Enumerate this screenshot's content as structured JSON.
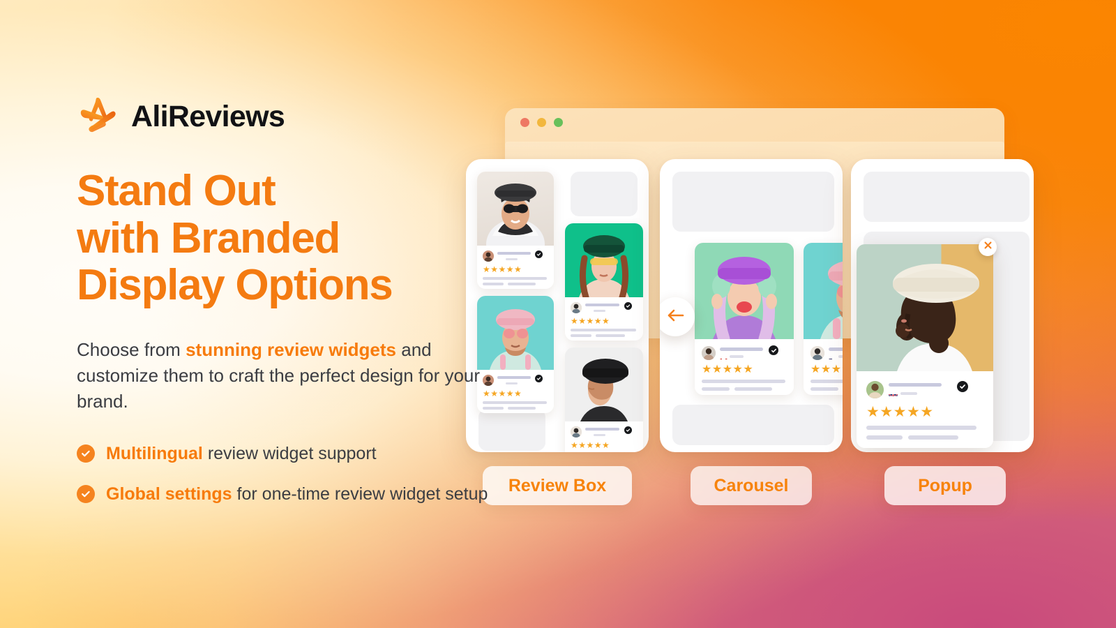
{
  "brand": {
    "logo_icon": "alireviews-star-logo",
    "name": "AliReviews"
  },
  "hero": {
    "headline": "Stand Out\nwith Branded\nDisplay Options",
    "subcopy_pre": "Choose from ",
    "subcopy_highlight": "stunning review widgets",
    "subcopy_post": " and customize them to craft the perfect design for your brand."
  },
  "bullets": [
    {
      "highlight": "Multilingual",
      "rest": " review widget support",
      "icon": "check-circle-icon"
    },
    {
      "highlight": "Global settings",
      "rest": " for one-time review widget setup",
      "icon": "check-circle-icon"
    }
  ],
  "browser": {
    "traffic_lights": [
      "red",
      "yellow",
      "green"
    ]
  },
  "widgets": [
    {
      "id": "review-box",
      "label": "Review Box",
      "type": "masonry-grid",
      "reviews": [
        {
          "stars": 5,
          "flag": "canada",
          "verified": true,
          "photo_bg": "#EDE7E1"
        },
        {
          "stars": 5,
          "flag": "canada",
          "verified": true,
          "photo_bg": "#6FD3D0"
        },
        {
          "stars": 5,
          "flag": "usa",
          "verified": true,
          "photo_bg": "#0FC08A"
        },
        {
          "stars": 5,
          "flag": "usa",
          "verified": true,
          "photo_bg": "#EFEFEF"
        }
      ]
    },
    {
      "id": "carousel",
      "label": "Carousel",
      "type": "carousel",
      "prev_icon": "arrow-left-icon",
      "reviews": [
        {
          "stars": 5,
          "flag": "canada",
          "verified": true,
          "photo_bg": "#8FD9B6"
        },
        {
          "stars": 5,
          "flag": "usa",
          "verified": true,
          "photo_bg": "#6FD3D0"
        }
      ]
    },
    {
      "id": "popup",
      "label": "Popup",
      "type": "popup",
      "close_icon": "close-x-icon",
      "reviews": [
        {
          "stars": 5,
          "flag": "uk",
          "verified": true,
          "photo_bg": "#BCD3C6"
        }
      ]
    }
  ],
  "colors": {
    "brand_orange": "#F7830B",
    "headline_orange": "#F47B11",
    "body_text": "#3B3D42",
    "star_gold": "#F5A623",
    "logo_text": "#111215"
  }
}
